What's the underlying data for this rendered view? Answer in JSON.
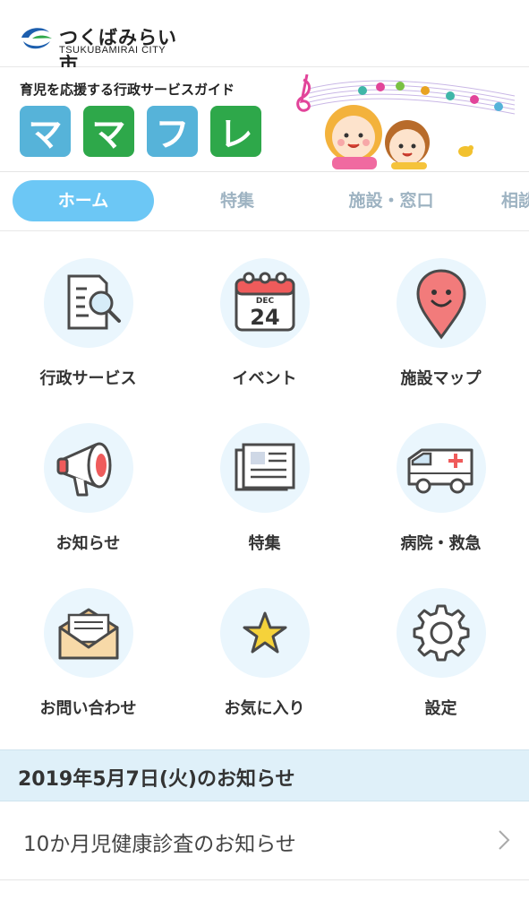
{
  "header": {
    "city_name": "つくばみらい市",
    "city_name_en": "TSUKUBAMIRAI CITY"
  },
  "banner": {
    "tagline": "育児を応援する行政サービスガイド",
    "logo_chars": [
      "マ",
      "マ",
      "フ",
      "レ"
    ]
  },
  "tabs": [
    {
      "label": "ホーム",
      "active": true
    },
    {
      "label": "特集",
      "active": false
    },
    {
      "label": "施設・窓口",
      "active": false
    },
    {
      "label": "相談",
      "active": false
    }
  ],
  "menu": [
    {
      "label": "行政サービス",
      "icon": "document-search-icon"
    },
    {
      "label": "イベント",
      "icon": "calendar-icon"
    },
    {
      "label": "施設マップ",
      "icon": "map-pin-icon"
    },
    {
      "label": "お知らせ",
      "icon": "megaphone-icon"
    },
    {
      "label": "特集",
      "icon": "newspaper-icon"
    },
    {
      "label": "病院・救急",
      "icon": "ambulance-icon"
    },
    {
      "label": "お問い合わせ",
      "icon": "envelope-icon"
    },
    {
      "label": "お気に入り",
      "icon": "star-icon"
    },
    {
      "label": "設定",
      "icon": "gear-icon"
    }
  ],
  "calendar_icon": {
    "month": "DEC",
    "day": "24"
  },
  "news": {
    "date_heading": "2019年5月7日(火)のお知らせ",
    "items": [
      {
        "title": "10か月児健康診査のお知らせ"
      }
    ]
  },
  "colors": {
    "tab_active": "#6cc7f5",
    "tab_inactive_text": "#9eb3c2",
    "tile_blue": "#56b3d9",
    "tile_green": "#2ea84a",
    "icon_bg": "#eaf6fd",
    "news_header_bg": "#dff0f9"
  }
}
